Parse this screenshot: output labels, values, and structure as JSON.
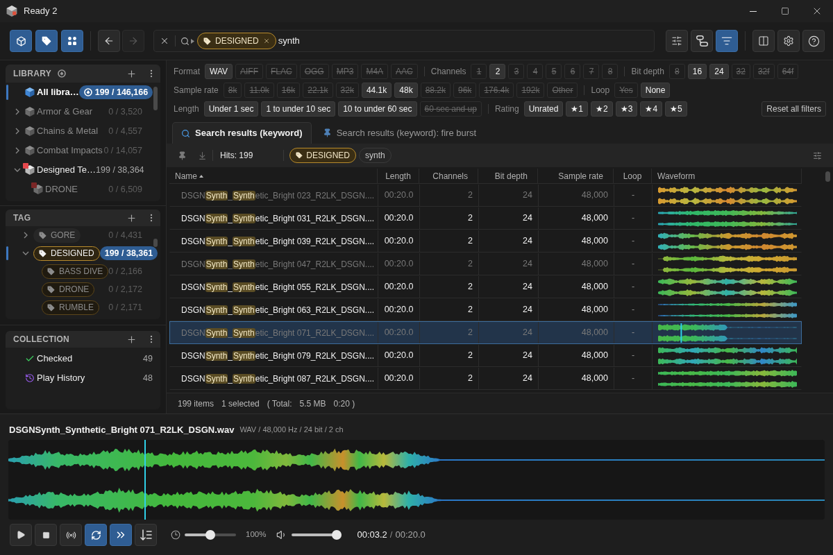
{
  "window": {
    "title": "Ready 2"
  },
  "toolbar": {
    "mode_buttons": [
      {
        "kind": "library",
        "selected": true
      },
      {
        "kind": "tag",
        "selected": true
      },
      {
        "kind": "collection",
        "selected": true
      }
    ],
    "nav_buttons": [
      {
        "kind": "back",
        "disabled": false
      },
      {
        "kind": "forward",
        "disabled": true
      }
    ],
    "search": {
      "tag": "DESIGNED",
      "value": "synth"
    },
    "view_buttons": [
      {
        "kind": "sliders",
        "selected": false
      },
      {
        "kind": "pills",
        "selected": false
      },
      {
        "kind": "filter",
        "selected": true
      }
    ],
    "app_buttons": [
      {
        "kind": "panel"
      },
      {
        "kind": "settings"
      },
      {
        "kind": "help"
      }
    ]
  },
  "sidebar": {
    "library": {
      "title": "LIBRARY",
      "items": [
        {
          "kind": "all",
          "label": "All libra…",
          "count": "199 / 146,166",
          "selected": true,
          "dimmed": false
        },
        {
          "kind": "library",
          "label": "Armor & Gear",
          "count": "0 / 3,520",
          "selected": false,
          "dimmed": true,
          "expanded": false
        },
        {
          "kind": "library",
          "label": "Chains & Metal",
          "count": "0 / 4,557",
          "selected": false,
          "dimmed": true,
          "expanded": false
        },
        {
          "kind": "library",
          "label": "Combat Impacts",
          "count": "0 / 14,057",
          "selected": false,
          "dimmed": true,
          "expanded": false
        },
        {
          "kind": "library",
          "label": "Designed Te…",
          "count": "199 / 38,364",
          "selected": false,
          "dimmed": false,
          "expanded": true,
          "color": "#e5484d",
          "children": [
            {
              "kind": "library",
              "label": "DRONE",
              "count": "0 / 6,509",
              "selected": false,
              "dimmed": true,
              "color": "#7a2626"
            }
          ]
        }
      ]
    },
    "tag": {
      "title": "TAG",
      "items": [
        {
          "label": "GORE",
          "count": "0 / 4,431",
          "selected": false,
          "dimmed": true,
          "expanded": false
        },
        {
          "label": "DESIGNED",
          "count": "199 / 38,361",
          "selected": true,
          "dimmed": false,
          "expanded": true,
          "children": [
            {
              "label": "BASS DIVE",
              "count": "0 / 2,166",
              "selected": false,
              "dimmed": true
            },
            {
              "label": "DRONE",
              "count": "0 / 2,172",
              "selected": false,
              "dimmed": true
            },
            {
              "label": "RUMBLE",
              "count": "0 / 2,171",
              "selected": false,
              "dimmed": true
            }
          ]
        }
      ]
    },
    "collection": {
      "title": "COLLECTION",
      "items": [
        {
          "kind": "checked",
          "label": "Checked",
          "count": "49"
        },
        {
          "kind": "history",
          "label": "Play History",
          "count": "48"
        }
      ]
    }
  },
  "filters": {
    "rows": [
      {
        "groups": [
          {
            "label": "Format",
            "options": [
              {
                "label": "WAV",
                "on": true
              },
              {
                "label": "AIFF",
                "on": false
              },
              {
                "label": "FLAC",
                "on": false
              },
              {
                "label": "OGG",
                "on": false
              },
              {
                "label": "MP3",
                "on": false
              },
              {
                "label": "M4A",
                "on": false
              },
              {
                "label": "AAC",
                "on": false
              }
            ]
          },
          {
            "label": "Channels",
            "options": [
              {
                "label": "1",
                "on": false
              },
              {
                "label": "2",
                "on": true
              },
              {
                "label": "3",
                "on": false
              },
              {
                "label": "4",
                "on": false
              },
              {
                "label": "5",
                "on": false
              },
              {
                "label": "6",
                "on": false
              },
              {
                "label": "7",
                "on": false
              },
              {
                "label": "8",
                "on": false
              }
            ]
          },
          {
            "label": "Bit depth",
            "options": [
              {
                "label": "8",
                "on": false
              },
              {
                "label": "16",
                "on": true
              },
              {
                "label": "24",
                "on": true
              },
              {
                "label": "32",
                "on": false
              },
              {
                "label": "32f",
                "on": false
              },
              {
                "label": "64f",
                "on": false
              }
            ]
          }
        ]
      },
      {
        "groups": [
          {
            "label": "Sample rate",
            "options": [
              {
                "label": "8k",
                "on": false
              },
              {
                "label": "11.0k",
                "on": false
              },
              {
                "label": "16k",
                "on": false
              },
              {
                "label": "22.1k",
                "on": false
              },
              {
                "label": "32k",
                "on": false
              },
              {
                "label": "44.1k",
                "on": true
              },
              {
                "label": "48k",
                "on": true
              },
              {
                "label": "88.2k",
                "on": false
              },
              {
                "label": "96k",
                "on": false
              },
              {
                "label": "176.4k",
                "on": false
              },
              {
                "label": "192k",
                "on": false
              },
              {
                "label": "Other",
                "on": false
              }
            ]
          },
          {
            "label": "Loop",
            "options": [
              {
                "label": "Yes",
                "on": false
              },
              {
                "label": "None",
                "on": true
              }
            ]
          }
        ]
      },
      {
        "groups": [
          {
            "label": "Length",
            "options": [
              {
                "label": "Under 1 sec",
                "on": true
              },
              {
                "label": "1 to under 10 sec",
                "on": true
              },
              {
                "label": "10 to under 60 sec",
                "on": true
              },
              {
                "label": "60 sec and up",
                "on": false
              }
            ]
          },
          {
            "label": "Rating",
            "options": [
              {
                "label": "Unrated",
                "on": true
              },
              {
                "label": "★1",
                "on": true
              },
              {
                "label": "★2",
                "on": true
              },
              {
                "label": "★3",
                "on": true
              },
              {
                "label": "★4",
                "on": true
              },
              {
                "label": "★5",
                "on": true
              }
            ]
          }
        ]
      }
    ],
    "reset_button": "Reset all filters"
  },
  "results": {
    "tabs": [
      {
        "kind": "search",
        "label": "Search results (keyword)",
        "selected": true
      },
      {
        "kind": "pinned",
        "label": "Search results (keyword): fire burst",
        "selected": false
      }
    ],
    "hits": "Hits: 199",
    "chips": [
      {
        "kind": "tag",
        "label": "DESIGNED"
      },
      {
        "kind": "keyword",
        "label": "synth"
      }
    ],
    "table": {
      "columns": [
        {
          "label": "Name",
          "sorted": true
        },
        {
          "label": "Length",
          "sorted": false
        },
        {
          "label": "Channels",
          "sorted": false
        },
        {
          "label": "Bit depth",
          "sorted": false
        },
        {
          "label": "Sample rate",
          "sorted": false
        },
        {
          "label": "Loop",
          "sorted": false
        },
        {
          "label": "Waveform",
          "sorted": false
        }
      ],
      "rows": [
        {
          "name": [
            {
              "text": "DSGN",
              "match": false
            },
            {
              "text": "Synth",
              "match": true
            },
            {
              "text": "_",
              "match": false
            },
            {
              "text": "Synth",
              "match": true
            },
            {
              "text": "etic_Bright 023_R2LK_DSGN....",
              "match": false
            }
          ],
          "length": "00:20.0",
          "channels": "2",
          "bit_depth": "24",
          "sample_rate": "48,000",
          "loop": "-",
          "dimmed": true,
          "selected": false
        },
        {
          "name": [
            {
              "text": "DSGN",
              "match": false
            },
            {
              "text": "Synth",
              "match": true
            },
            {
              "text": "_",
              "match": false
            },
            {
              "text": "Synth",
              "match": true
            },
            {
              "text": "etic_Bright 031_R2LK_DSGN....",
              "match": false
            }
          ],
          "length": "00:20.0",
          "channels": "2",
          "bit_depth": "24",
          "sample_rate": "48,000",
          "loop": "-",
          "dimmed": false,
          "selected": false
        },
        {
          "name": [
            {
              "text": "DSGN",
              "match": false
            },
            {
              "text": "Synth",
              "match": true
            },
            {
              "text": "_",
              "match": false
            },
            {
              "text": "Synth",
              "match": true
            },
            {
              "text": "etic_Bright 039_R2LK_DSGN....",
              "match": false
            }
          ],
          "length": "00:20.0",
          "channels": "2",
          "bit_depth": "24",
          "sample_rate": "48,000",
          "loop": "-",
          "dimmed": false,
          "selected": false
        },
        {
          "name": [
            {
              "text": "DSGN",
              "match": false
            },
            {
              "text": "Synth",
              "match": true
            },
            {
              "text": "_",
              "match": false
            },
            {
              "text": "Synth",
              "match": true
            },
            {
              "text": "etic_Bright 047_R2LK_DSGN....",
              "match": false
            }
          ],
          "length": "00:20.0",
          "channels": "2",
          "bit_depth": "24",
          "sample_rate": "48,000",
          "loop": "-",
          "dimmed": true,
          "selected": false
        },
        {
          "name": [
            {
              "text": "DSGN",
              "match": false
            },
            {
              "text": "Synth",
              "match": true
            },
            {
              "text": "_",
              "match": false
            },
            {
              "text": "Synth",
              "match": true
            },
            {
              "text": "etic_Bright 055_R2LK_DSGN....",
              "match": false
            }
          ],
          "length": "00:20.0",
          "channels": "2",
          "bit_depth": "24",
          "sample_rate": "48,000",
          "loop": "-",
          "dimmed": false,
          "selected": false
        },
        {
          "name": [
            {
              "text": "DSGN",
              "match": false
            },
            {
              "text": "Synth",
              "match": true
            },
            {
              "text": "_",
              "match": false
            },
            {
              "text": "Synth",
              "match": true
            },
            {
              "text": "etic_Bright 063_R2LK_DSGN....",
              "match": false
            }
          ],
          "length": "00:20.0",
          "channels": "2",
          "bit_depth": "24",
          "sample_rate": "48,000",
          "loop": "-",
          "dimmed": false,
          "selected": false
        },
        {
          "name": [
            {
              "text": "DSGN",
              "match": false
            },
            {
              "text": "Synth",
              "match": true
            },
            {
              "text": "_",
              "match": false
            },
            {
              "text": "Synth",
              "match": true
            },
            {
              "text": "etic_Bright 071_R2LK_DSGN....",
              "match": false
            }
          ],
          "length": "00:20.0",
          "channels": "2",
          "bit_depth": "24",
          "sample_rate": "48,000",
          "loop": "-",
          "dimmed": true,
          "selected": true
        },
        {
          "name": [
            {
              "text": "DSGN",
              "match": false
            },
            {
              "text": "Synth",
              "match": true
            },
            {
              "text": "_",
              "match": false
            },
            {
              "text": "Synth",
              "match": true
            },
            {
              "text": "etic_Bright 079_R2LK_DSGN....",
              "match": false
            }
          ],
          "length": "00:20.0",
          "channels": "2",
          "bit_depth": "24",
          "sample_rate": "48,000",
          "loop": "-",
          "dimmed": false,
          "selected": false
        },
        {
          "name": [
            {
              "text": "DSGN",
              "match": false
            },
            {
              "text": "Synth",
              "match": true
            },
            {
              "text": "_",
              "match": false
            },
            {
              "text": "Synth",
              "match": true
            },
            {
              "text": "etic_Bright 087_R2LK_DSGN....",
              "match": false
            }
          ],
          "length": "00:20.0",
          "channels": "2",
          "bit_depth": "24",
          "sample_rate": "48,000",
          "loop": "-",
          "dimmed": false,
          "selected": false
        }
      ]
    },
    "status": [
      "199 items",
      "1 selected",
      "( Total:",
      "5.5 MB",
      "0:20 )"
    ]
  },
  "player": {
    "title": "DSGNSynth_Synthetic_Bright 071_R2LK_DSGN.wav",
    "info": "WAV / 48,000 Hz / 24 bit / 2 ch",
    "progress": {
      "level": 0.167
    },
    "buttons": [
      {
        "kind": "play",
        "selected": false
      },
      {
        "kind": "stop",
        "selected": false
      },
      {
        "kind": "broadcast",
        "selected": false
      },
      {
        "kind": "repeat",
        "selected": true
      },
      {
        "kind": "auto_advance",
        "selected": true
      },
      {
        "kind": "order",
        "selected": false
      }
    ],
    "speed": {
      "level": 0.5,
      "reading": "100%"
    },
    "volume": {
      "level": 1
    },
    "position": "00:03.2",
    "separator": "/",
    "duration": "00:20.0"
  }
}
